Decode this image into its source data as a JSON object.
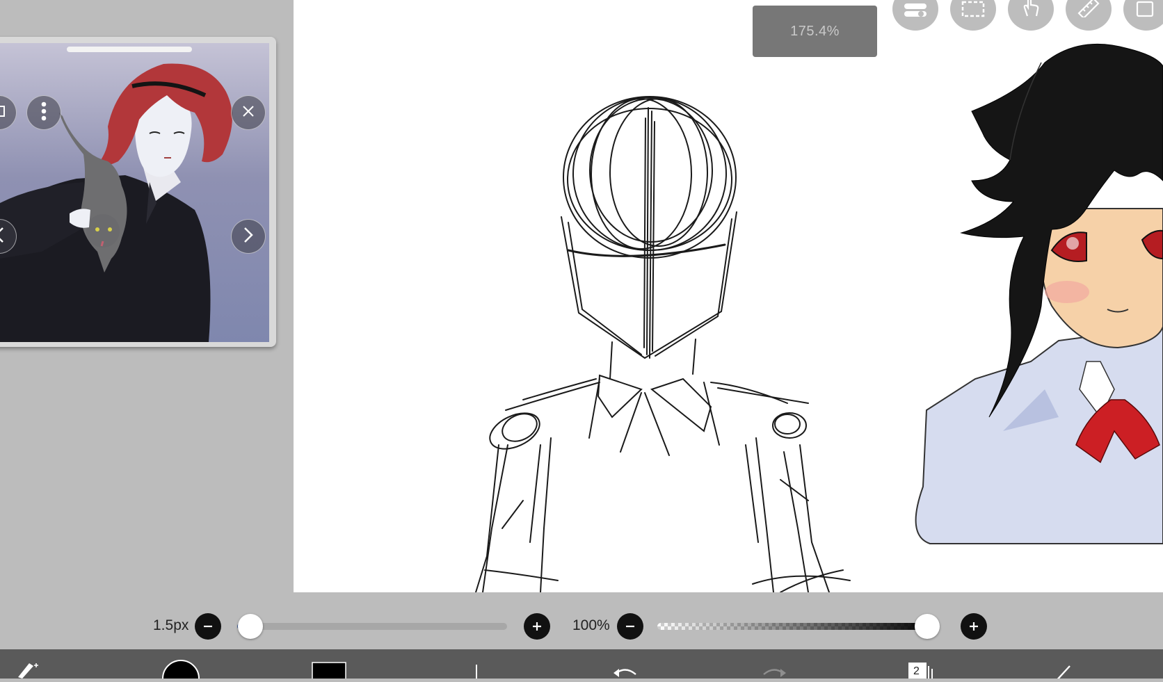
{
  "canvas": {
    "zoom_label": "175.4%"
  },
  "top_tools": [
    {
      "name": "toggle-panel-tool-icon"
    },
    {
      "name": "selection-tool-icon"
    },
    {
      "name": "hand-tool-icon"
    },
    {
      "name": "ruler-tool-icon"
    },
    {
      "name": "image-reference-icon"
    }
  ],
  "reference_panel": {
    "buttons": [
      "window-mode-icon",
      "more-options-icon",
      "close-icon",
      "previous-icon",
      "next-icon"
    ]
  },
  "brush": {
    "size_label": "1.5px",
    "size_fraction": 0.05,
    "opacity_label": "100%",
    "opacity_fraction": 1.0
  },
  "toolbar": {
    "items": [
      "brush-tool-icon",
      "color-swatch",
      "secondary-color-swatch",
      "brush-preview",
      "undo-icon",
      "redo-icon",
      "layers-icon",
      "pen-icon"
    ],
    "layer_count": "2",
    "primary_color": "#000000"
  },
  "colors": {
    "background": "#bcbcbc",
    "canvas": "#ffffff",
    "toolbar": "#5a5a5a",
    "accent": "#3a5a9a"
  }
}
